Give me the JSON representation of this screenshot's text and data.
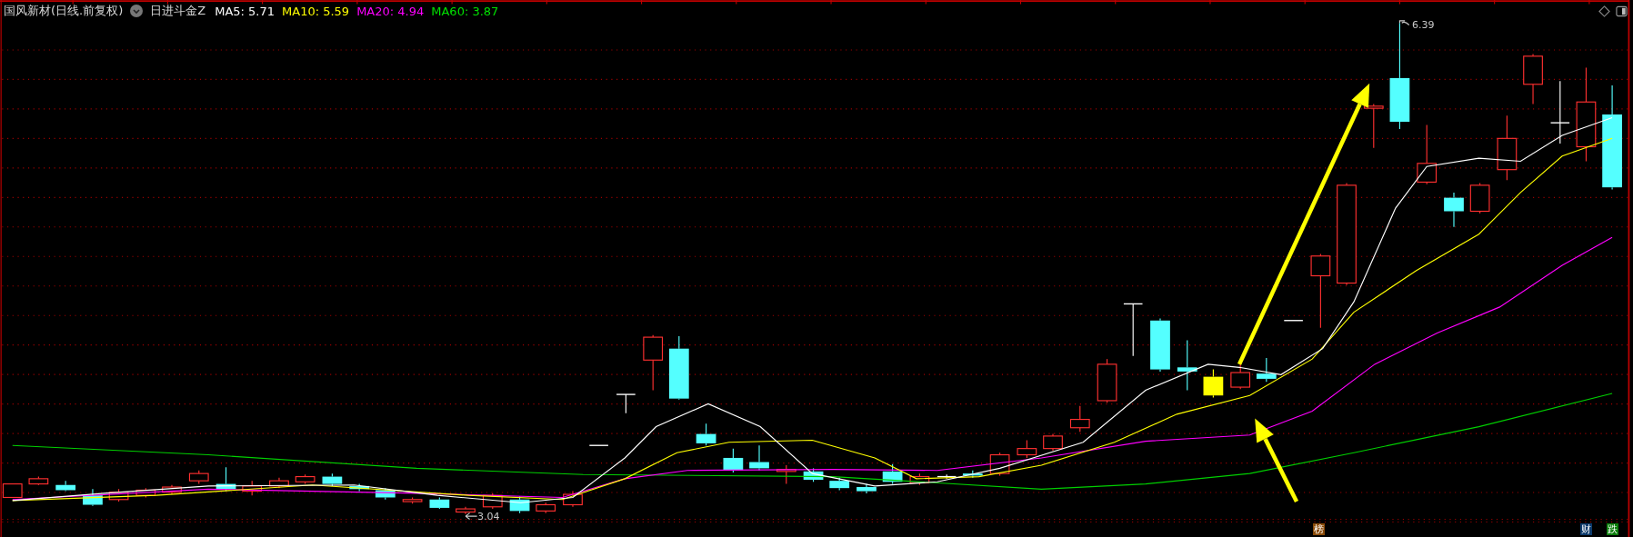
{
  "header": {
    "title": "国风新材(日线.前复权)",
    "indicator": "日进斗金Z",
    "ma": [
      {
        "label": "MA5: 5.71",
        "color": "#ffffff"
      },
      {
        "label": "MA10: 5.59",
        "color": "#ffff00"
      },
      {
        "label": "MA20: 4.94",
        "color": "#ff00ff"
      },
      {
        "label": "MA60: 3.87",
        "color": "#00e000"
      }
    ]
  },
  "chart": {
    "high_label": "6.39",
    "low_label": "3.04"
  },
  "badges": [
    {
      "text": "榜",
      "color": "#8a4b08"
    },
    {
      "text": "财",
      "color": "#0c3a6b"
    },
    {
      "text": "跌",
      "color": "#0b7d0b"
    }
  ]
}
